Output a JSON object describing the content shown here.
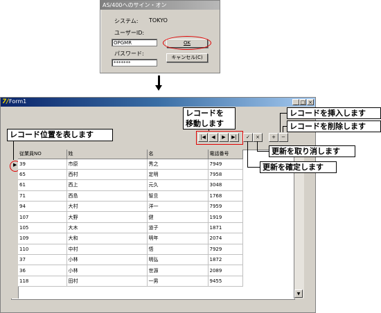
{
  "signon_dialog": {
    "title": "AS/400へのサイン・オン",
    "system_label": "システム:",
    "system_value": "TOKYO",
    "userid_label": "ユーザーID:",
    "userid_value": "OPGMR",
    "password_label": "パスワード:",
    "password_value": "*******",
    "ok_label": "OK",
    "cancel_label": "キャンセル(C)"
  },
  "form_window": {
    "title": "Form1",
    "logo": "7/",
    "min_label": "_",
    "max_label": "□",
    "close_label": "×"
  },
  "navigator": {
    "first": "|◀",
    "prior": "◀",
    "next": "▶",
    "last": "▶|",
    "post": "✓",
    "cancel": "×",
    "insert": "+",
    "delete": "−"
  },
  "grid": {
    "indicator": "▶",
    "columns": [
      "従業員NO",
      "姓",
      "名",
      "電話番号"
    ],
    "rows": [
      [
        "39",
        "市原",
        "秀之",
        "7949"
      ],
      [
        "65",
        "西村",
        "定明",
        "7958"
      ],
      [
        "61",
        "西上",
        "元久",
        "3048"
      ],
      [
        "71",
        "西島",
        "智旦",
        "1768"
      ],
      [
        "94",
        "大村",
        "洋一",
        "7959"
      ],
      [
        "107",
        "大野",
        "健",
        "1919"
      ],
      [
        "105",
        "大木",
        "道子",
        "1871"
      ],
      [
        "109",
        "大和",
        "明年",
        "2074"
      ],
      [
        "110",
        "中村",
        "悟",
        "7929"
      ],
      [
        "37",
        "小林",
        "明弘",
        "1872"
      ],
      [
        "36",
        "小林",
        "世源",
        "2089"
      ],
      [
        "118",
        "田村",
        "一男",
        "9455"
      ]
    ],
    "scroll_down": "▼"
  },
  "callouts": {
    "move_record_line1": "レコードを",
    "move_record_line2": "移動します",
    "record_position": "レコード位置を表します",
    "insert_record": "レコードを挿入します",
    "delete_record": "レコードを削除します",
    "cancel_update": "更新を取り消します",
    "confirm_update": "更新を確定します"
  },
  "colors": {
    "highlight": "#e00000",
    "title_bar_start": "#0a246a",
    "face": "#d4d0c8"
  }
}
